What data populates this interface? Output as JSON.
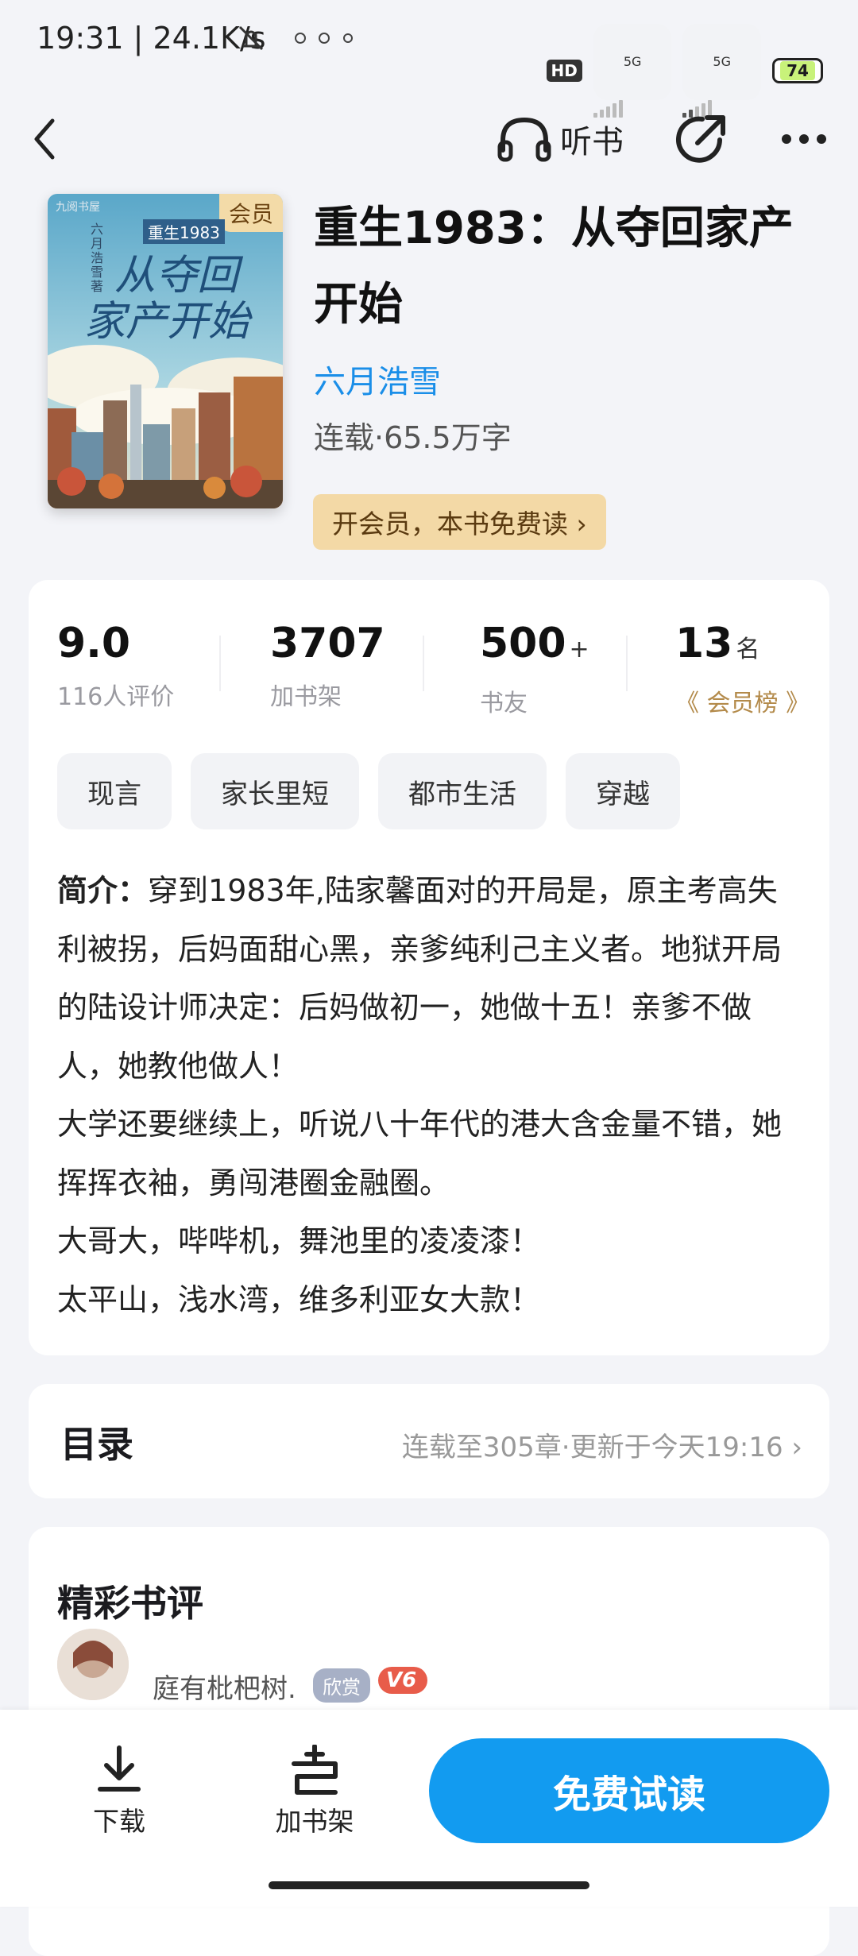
{
  "status_bar": {
    "time": "19:31 | 24.1K/s",
    "network_hd": "HD",
    "network_1": "5G",
    "network_2": "5G",
    "battery": "74"
  },
  "nav": {
    "listen_label": "听书"
  },
  "book": {
    "title": "重生1983：从夺回家产开始",
    "author": "六月浩雪",
    "meta": "连载·65.5万字",
    "vip_banner": "开会员，本书免费读 ›",
    "cover": {
      "badge": "会员",
      "publisher": "九阅书屋",
      "series_text": "重生1983",
      "author_vertical": "六月浩雪著",
      "title_line1": "从夺回",
      "title_line2": "家产开始"
    }
  },
  "stats": [
    {
      "value": "9.0",
      "suffix": "",
      "label": "116人评价"
    },
    {
      "value": "3707",
      "suffix": "",
      "label": "加书架"
    },
    {
      "value": "500",
      "suffix": "+",
      "label": "书友"
    },
    {
      "value": "13",
      "suffix": "名",
      "label": "《 会员榜 》"
    }
  ],
  "tags": [
    "现言",
    "家长里短",
    "都市生活",
    "穿越"
  ],
  "synopsis": {
    "heading": "简介：",
    "lines": [
      "穿到1983年,陆家馨面对的开局是，原主考高失利被拐，后妈面甜心黑，亲爹纯利己主义者。地狱开局的陆设计师决定：后妈做初一，她做十五！亲爹不做人，她教他做人！",
      "大学还要继续上，听说八十年代的港大含金量不错，她挥挥衣袖，勇闯港圈金融圈。",
      "大哥大，哔哔机，舞池里的凌凌漆！",
      "太平山，浅水湾，维多利亚女大款！"
    ]
  },
  "toc": {
    "title": "目录",
    "info": "连载至305章·更新于今天19:16 ›"
  },
  "reviews": {
    "title": "精彩书评",
    "first_reviewer": {
      "name": "庭有枇杷树.",
      "badge": "欣赏",
      "level": "V6"
    }
  },
  "bottom_bar": {
    "download": "下载",
    "add_shelf": "加书架",
    "read": "免费试读"
  }
}
